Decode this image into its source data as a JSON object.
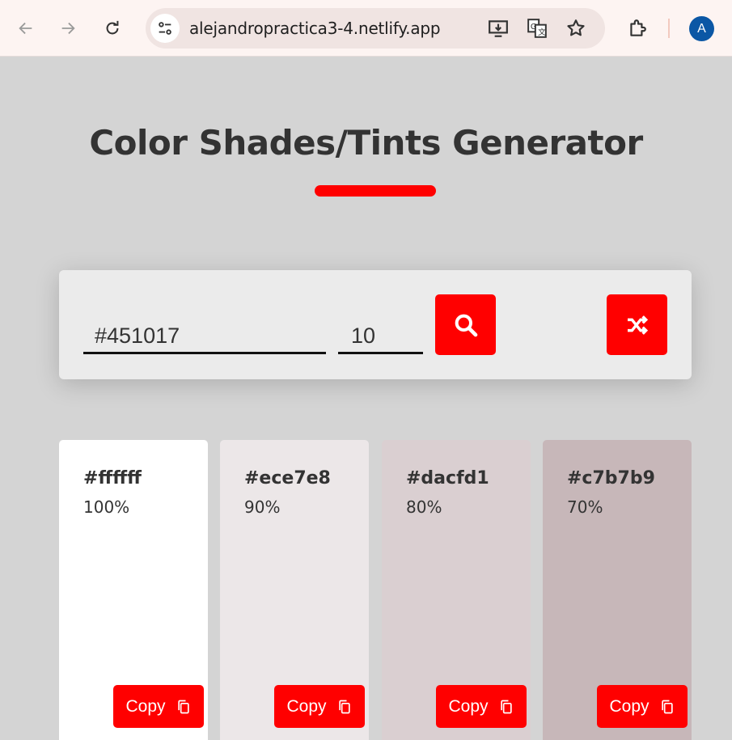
{
  "browser": {
    "url": "alejandropractica3-4.netlify.app",
    "profile_initial": "A",
    "icons": [
      "back-arrow-icon",
      "forward-arrow-icon",
      "reload-icon",
      "site-settings-icon",
      "install-app-icon",
      "translate-icon",
      "bookmark-star-icon",
      "extensions-icon"
    ]
  },
  "page": {
    "title": "Color Shades/Tints Generator",
    "accent_color": "#ff0000",
    "background_color": "#d4d4d4"
  },
  "form": {
    "color_value": "#451017",
    "percentage_value": "10",
    "search_icon": "search-icon",
    "random_icon": "shuffle-icon"
  },
  "shades": [
    {
      "hex": "#ffffff",
      "percent": "100%",
      "copy_label": "Copy",
      "bg": "#ffffff"
    },
    {
      "hex": "#ece7e8",
      "percent": "90%",
      "copy_label": "Copy",
      "bg": "#ece7e8"
    },
    {
      "hex": "#dacfd1",
      "percent": "80%",
      "copy_label": "Copy",
      "bg": "#dacfd1"
    },
    {
      "hex": "#c7b7b9",
      "percent": "70%",
      "copy_label": "Copy",
      "bg": "#c7b7b9"
    }
  ]
}
